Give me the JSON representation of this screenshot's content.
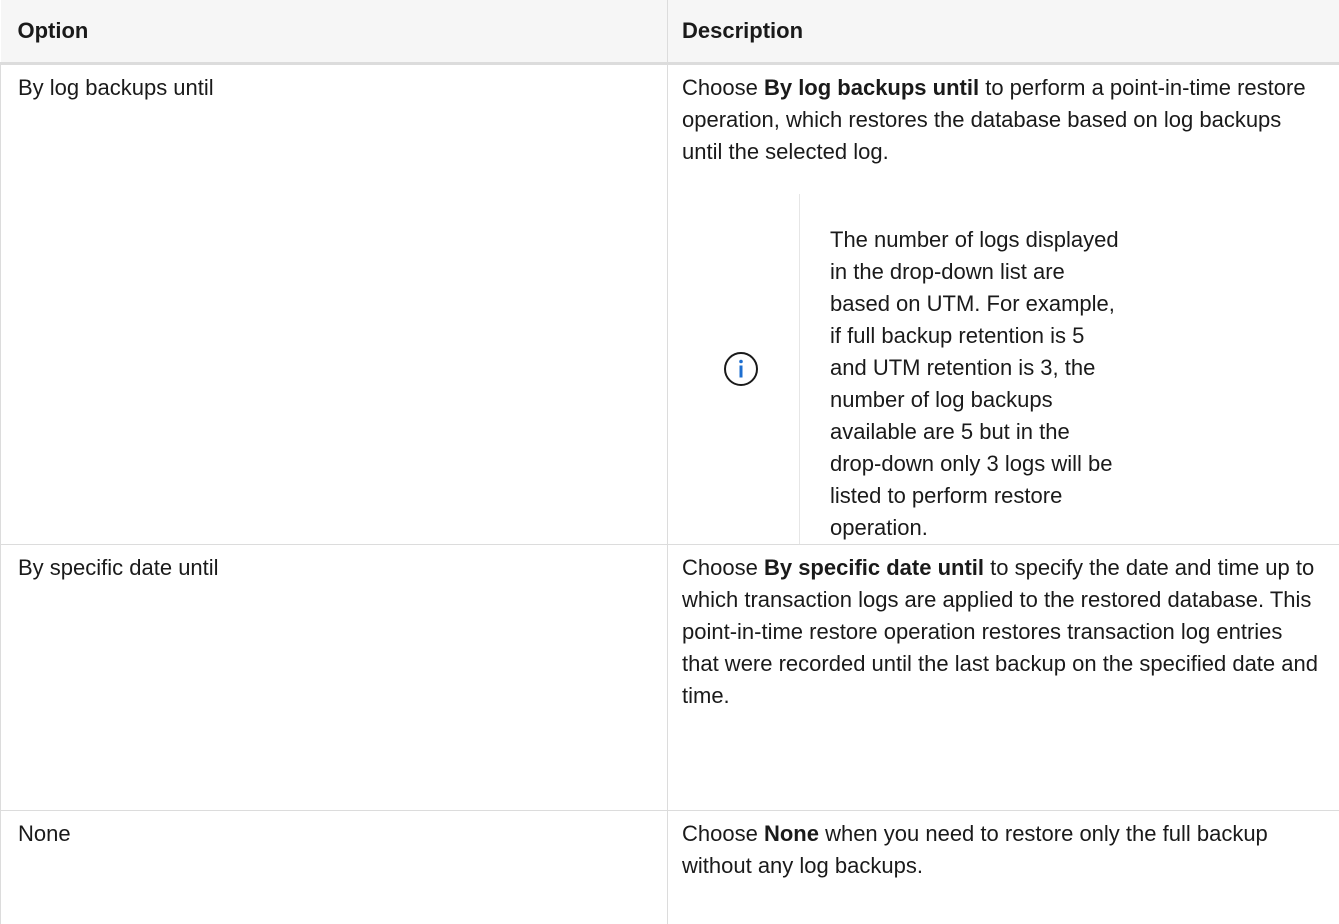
{
  "table": {
    "headers": {
      "option": "Option",
      "description": "Description"
    },
    "rows": [
      {
        "option": "By log backups until",
        "desc_prefix": "Choose ",
        "desc_bold": "By log backups until",
        "desc_suffix": " to perform a point-in-time restore operation, which restores the database based on log backups until the selected log.",
        "note": "The number of logs displayed in the drop-down list are based on UTM. For example, if full backup retention is 5 and UTM retention is 3, the number of log backups available are 5 but in the drop-down only 3 logs will be listed to perform restore operation."
      },
      {
        "option": "By specific date until",
        "desc_prefix": "Choose ",
        "desc_bold": "By specific date until",
        "desc_suffix": " to specify the date and time up to which transaction logs are applied to the restored database. This point-in-time restore operation restores transaction log entries that were recorded until the last backup on the specified date and time."
      },
      {
        "option": "None",
        "desc_prefix": "Choose ",
        "desc_bold": "None",
        "desc_suffix": " when you need to restore only the full backup without any log backups."
      }
    ]
  },
  "icons": {
    "note_icon": "info-circle-icon"
  },
  "colors": {
    "header_bg": "#f6f6f6",
    "border": "#dcdcdc",
    "info_icon_ring": "#1a1a1a",
    "info_icon_glyph": "#1e6fd0"
  }
}
